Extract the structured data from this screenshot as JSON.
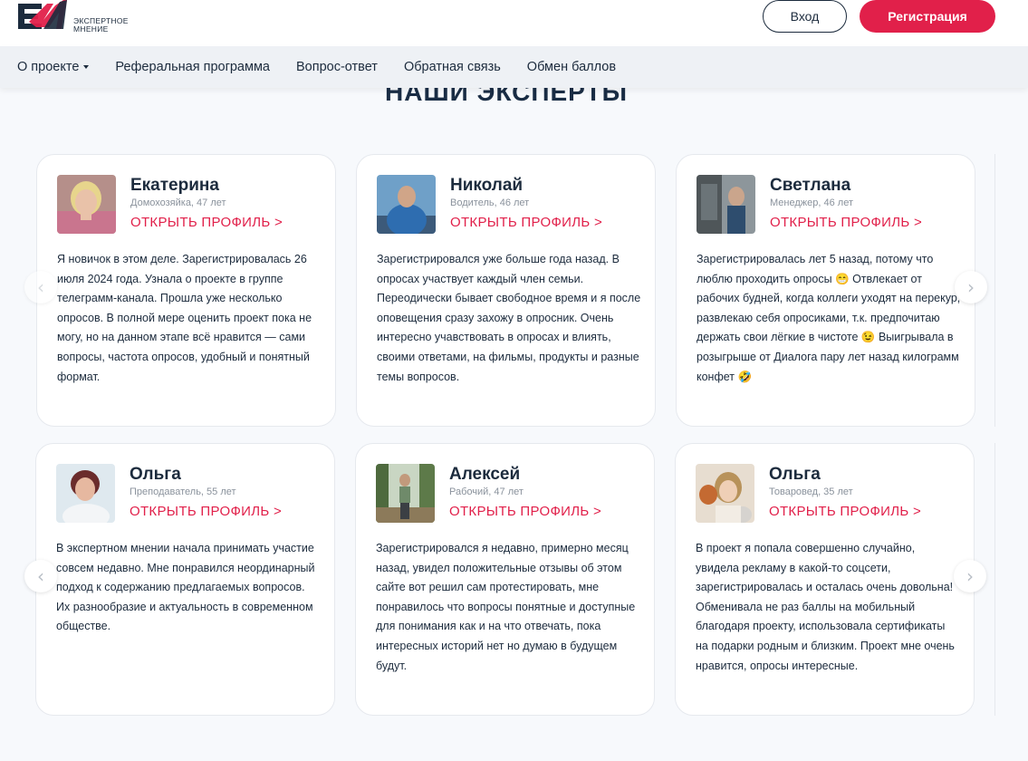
{
  "header": {
    "logo_line1": "ЭКСПЕРТНОЕ",
    "logo_line2": "МНЕНИЕ",
    "login_label": "Вход",
    "register_label": "Регистрация"
  },
  "nav": {
    "items": [
      {
        "label": "О проекте"
      },
      {
        "label": "Реферальная программа"
      },
      {
        "label": "Вопрос-ответ"
      },
      {
        "label": "Обратная связь"
      },
      {
        "label": "Обмен баллов"
      }
    ]
  },
  "section": {
    "title": "НАШИ ЭКСПЕРТЫ"
  },
  "colors": {
    "accent": "#e1204a",
    "text": "#1c2b3d",
    "muted": "#8a929c"
  },
  "experts": [
    {
      "name": "Екатерина",
      "occupation": "Домохозяйка, 47 лет",
      "link": "ОТКРЫТЬ ПРОФИЛЬ >",
      "review": "Я новичок в этом деле. Зарегистрировалась 26 июля 2024 года. Узнала о проекте в группе телеграмм-канала. Прошла уже несколько опросов. В полной мере оценить проект пока не могу, но на данном этапе всё нравится — сами вопросы, частота опросов, удобный и понятный формат."
    },
    {
      "name": "Николай",
      "occupation": "Водитель, 46 лет",
      "link": "ОТКРЫТЬ ПРОФИЛЬ >",
      "review": "Зарегистрировался уже больше года назад. В опросах участвует каждый член семьи. Переодически бывает свободное время и я после оповещения сразу захожу в опросник. Очень интересно учавствовать в опросах и влиять, своими ответами, на фильмы, продукты и разные темы вопросов."
    },
    {
      "name": "Светлана",
      "occupation": "Менеджер, 46 лет",
      "link": "ОТКРЫТЬ ПРОФИЛЬ >",
      "review": "Зарегистрировалась лет 5 назад, потому что люблю проходить опросы 😁 Отвлекает от рабочих будней, когда коллеги уходят на перекур, развлекаю себя опросиками, т.к. предпочитаю держать свои лёгкие в чистоте 😉 Выигрывала в розыгрыше от Диалога пару лет назад килограмм конфет 🤣"
    },
    {
      "name": "Ольга",
      "occupation": "Преподаватель, 55 лет",
      "link": "ОТКРЫТЬ ПРОФИЛЬ >",
      "review": "В экспертном мнении начала принимать участие совсем недавно. Мне понравился неординарный подход к содержанию предлагаемых вопросов. Их разнообразие и актуальность в современном обществе."
    },
    {
      "name": "Алексей",
      "occupation": "Рабочий, 47 лет",
      "link": "ОТКРЫТЬ ПРОФИЛЬ >",
      "review": "Зарегистрировался я недавно, примерно месяц назад, увидел положительные отзывы об этом сайте вот решил сам протестировать, мне понравилось что вопросы понятные и доступные для понимания как и на что отвечать, пока интересных историй нет но думаю в будущем будут."
    },
    {
      "name": "Ольга",
      "occupation": "Товаровед, 35 лет",
      "link": "ОТКРЫТЬ ПРОФИЛЬ >",
      "review": "В проект я попала совершенно случайно, увидела рекламу в какой-то соцсети, зарегистрировалась и осталась очень довольна! Обменивала не раз баллы на мобильный благодаря проекту, использовала сертификаты на подарки родным и близким. Проект мне очень нравится, опросы интересные."
    }
  ],
  "arrows": {
    "prev": "‹",
    "next": "›"
  }
}
